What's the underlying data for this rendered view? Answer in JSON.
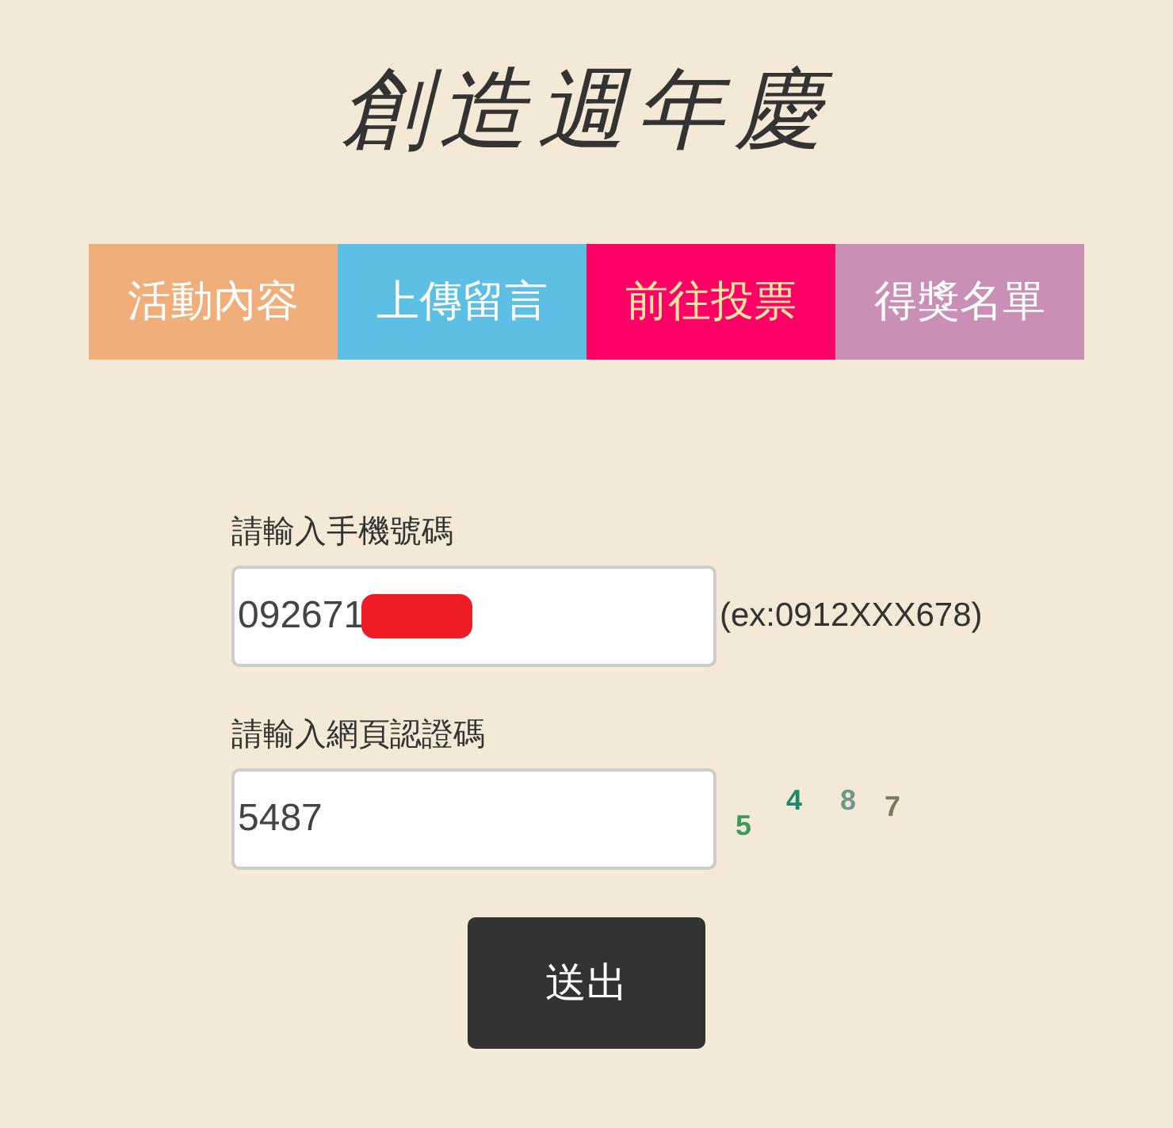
{
  "title": "創造週年慶",
  "tabs": [
    {
      "label": "活動內容",
      "color": "#f0ae7b",
      "selected": false
    },
    {
      "label": "上傳留言",
      "color": "#5dbfe3",
      "selected": false
    },
    {
      "label": "前往投票",
      "color": "#fe0066",
      "selected": true
    },
    {
      "label": "得獎名單",
      "color": "#c98fb5",
      "selected": false
    }
  ],
  "phone": {
    "label": "請輸入手機號碼",
    "value": "092671",
    "redacted": true,
    "hint": "(ex:0912XXX678)"
  },
  "captcha": {
    "label": "請輸入網頁認證碼",
    "value": "5487",
    "digits": [
      {
        "text": "5",
        "color": "#3a9a5a"
      },
      {
        "text": "4",
        "color": "#1f8a6a"
      },
      {
        "text": "8",
        "color": "#6a9a8a"
      },
      {
        "text": "7",
        "color": "#7a7a5a"
      }
    ]
  },
  "submit": "送出"
}
